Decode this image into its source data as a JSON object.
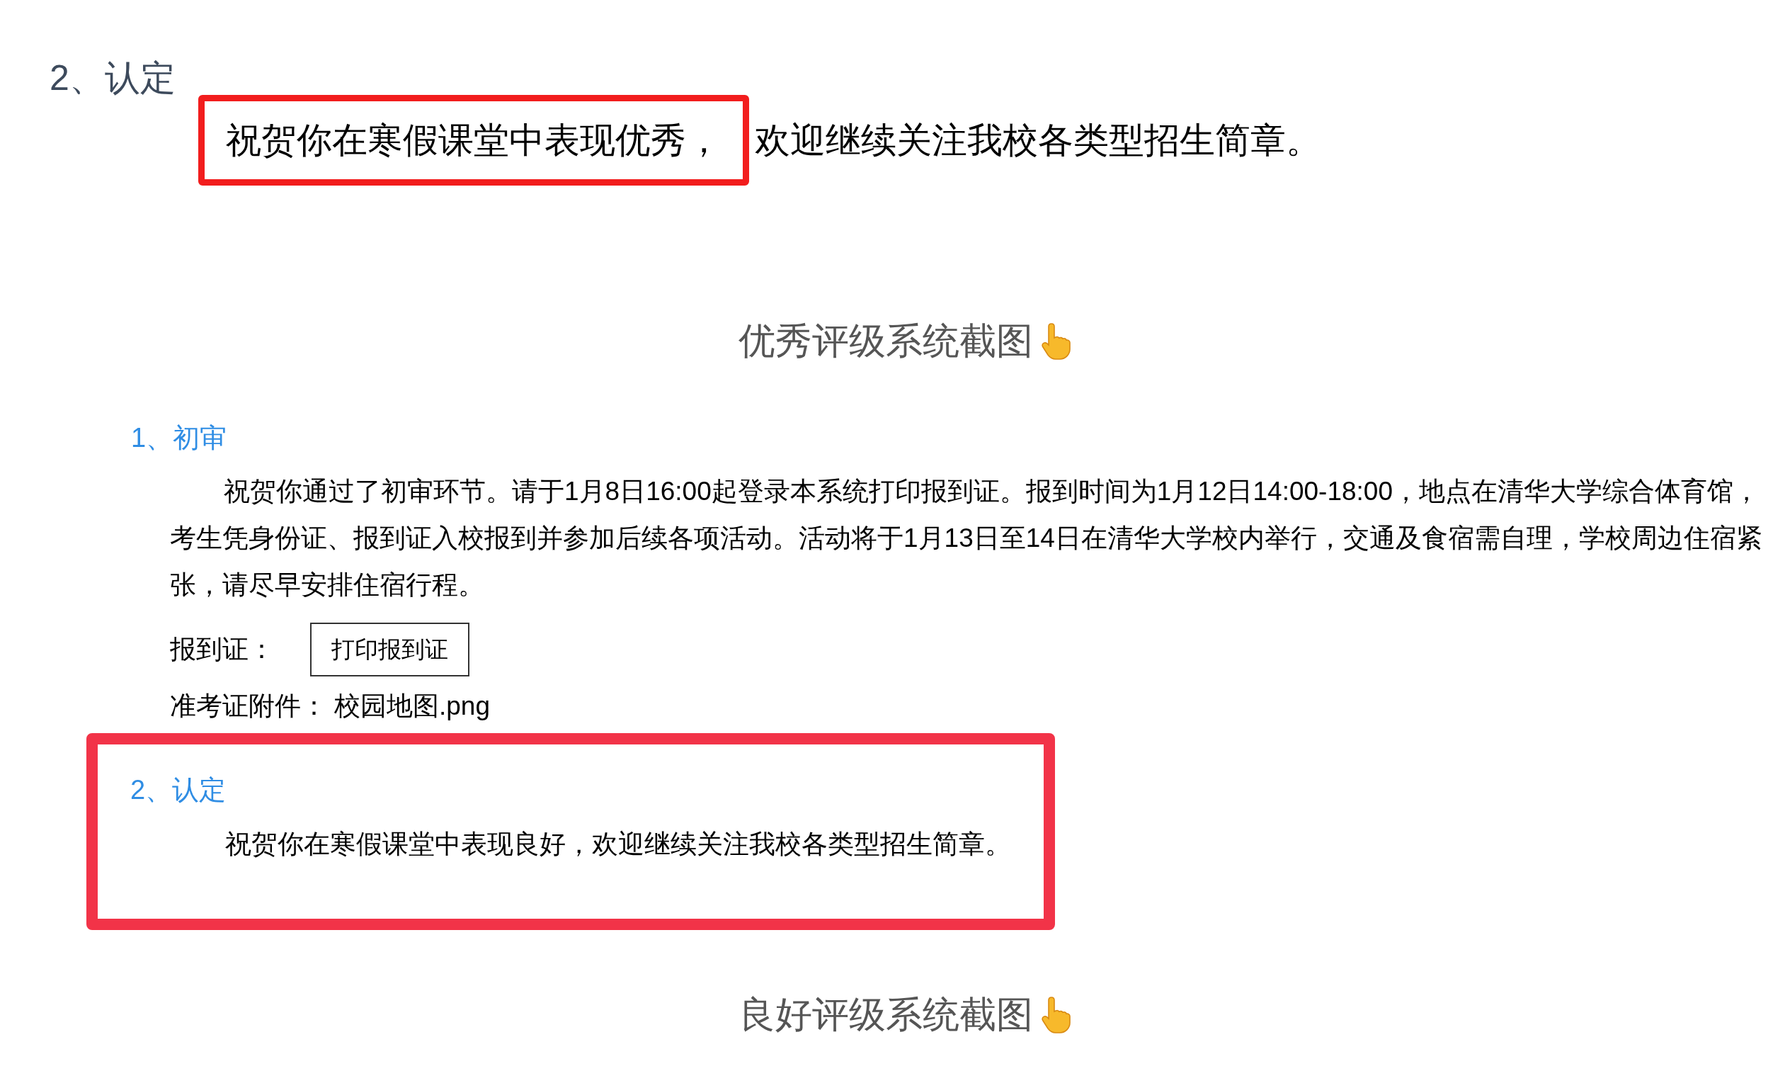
{
  "top_section": {
    "heading": "2、认定",
    "highlighted_text": "祝贺你在寒假课堂中表现优秀，",
    "text": "欢迎继续关注我校各类型招生简章。"
  },
  "caption_excellent": "优秀评级系统截图",
  "screenshot": {
    "first_review": {
      "heading": "1、初审",
      "paragraph": "祝贺你通过了初审环节。请于1月8日16:00起登录本系统打印报到证。报到时间为1月12日14:00-18:00，地点在清华大学综合体育馆，考生凭身份证、报到证入校报到并参加后续各项活动。活动将于1月13日至14日在清华大学校内举行，交通及食宿需自理，学校周边住宿紧张，请尽早安排住宿行程。",
      "admission_label": "报到证：",
      "print_button": "打印报到证",
      "attachment_label": "准考证附件：",
      "attachment_file": "校园地图.png"
    },
    "certification": {
      "heading": "2、认定",
      "text": "祝贺你在寒假课堂中表现良好，欢迎继续关注我校各类型招生简章。"
    }
  },
  "caption_good": "良好评级系统截图"
}
